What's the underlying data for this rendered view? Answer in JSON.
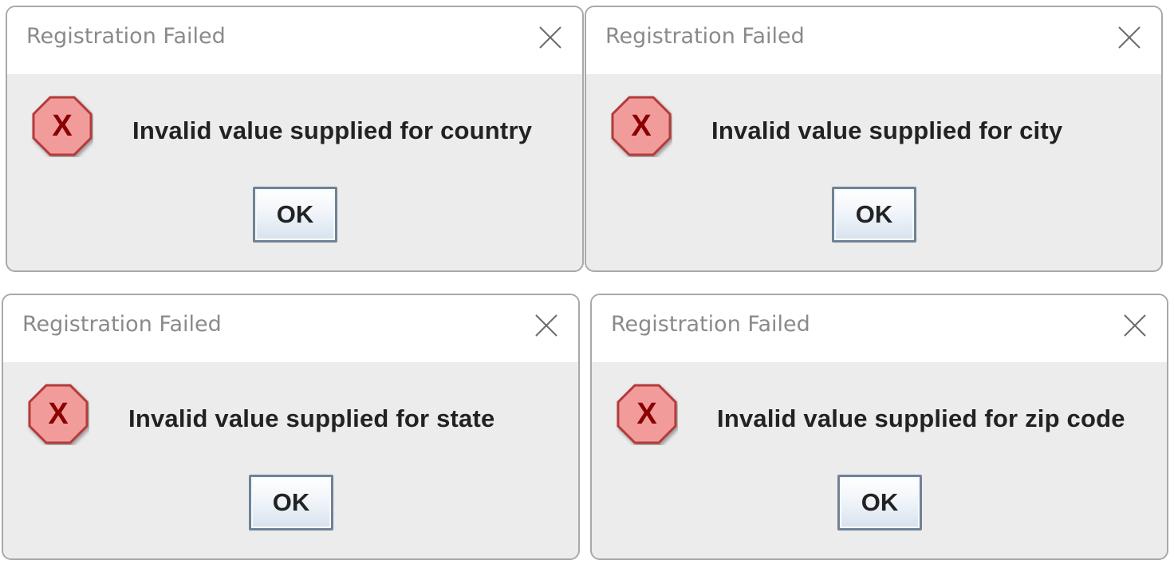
{
  "dialogs": [
    {
      "title": "Registration Failed",
      "message": "Invalid value supplied for country",
      "ok_label": "OK",
      "icon": "error-icon",
      "icon_glyph": "X"
    },
    {
      "title": "Registration Failed",
      "message": "Invalid value supplied for city",
      "ok_label": "OK",
      "icon": "error-icon",
      "icon_glyph": "X"
    },
    {
      "title": "Registration Failed",
      "message": "Invalid value supplied for state",
      "ok_label": "OK",
      "icon": "error-icon",
      "icon_glyph": "X"
    },
    {
      "title": "Registration Failed",
      "message": "Invalid value supplied for zip code",
      "ok_label": "OK",
      "icon": "error-icon",
      "icon_glyph": "X"
    }
  ],
  "colors": {
    "error_fill": "#f29b9b",
    "error_stroke": "#b23a3a",
    "error_glyph": "#8b0000",
    "dialog_body": "#ececec",
    "title_text": "#8a8a8a",
    "button_border": "#6f8296"
  }
}
